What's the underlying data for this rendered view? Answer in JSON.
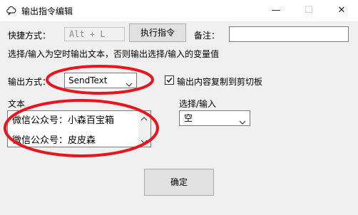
{
  "window": {
    "title": "输出指令编辑",
    "minimize_glyph": "—",
    "maximize_glyph": "☐",
    "close_glyph": "✕"
  },
  "hotkey": {
    "label": "快捷方式：",
    "value": "Alt + L"
  },
  "execute_button": "执行指令",
  "note": {
    "label": "备注：",
    "value": ""
  },
  "hint": "选择/输入为空时输出文本，否则输出选择/输入的变量值",
  "output_mode": {
    "label": "输出方式：",
    "selected": "SendText"
  },
  "copy_checkbox": {
    "label": "输出内容复制到剪切板",
    "checked": true
  },
  "text_section": {
    "label": "文本",
    "lines": [
      "微信公众号：小森百宝箱",
      "微信公众号：皮皮森"
    ]
  },
  "choice_section": {
    "label": "选择/输入",
    "selected": "空"
  },
  "ok_button": "确定",
  "annotation_color": "#e8141e",
  "icons": [
    "app-icon",
    "chevron-down-icon",
    "checkmark-icon",
    "scroll-up-icon",
    "scroll-down-icon"
  ]
}
